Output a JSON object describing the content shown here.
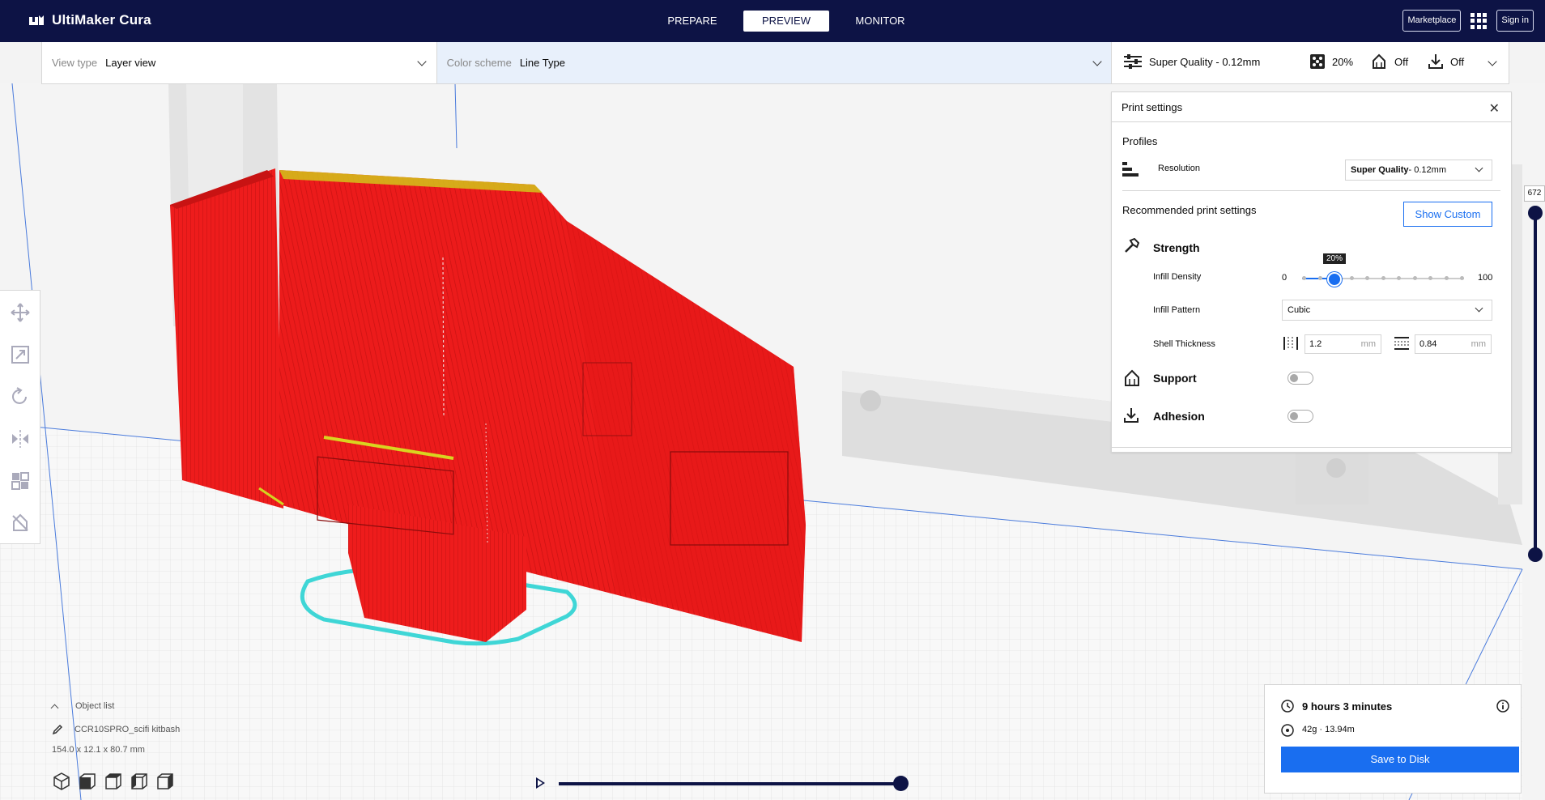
{
  "app": {
    "name": "UltiMaker Cura"
  },
  "stages": [
    {
      "label": "PREPARE",
      "active": false
    },
    {
      "label": "PREVIEW",
      "active": true
    },
    {
      "label": "MONITOR",
      "active": false
    }
  ],
  "topbar": {
    "marketplace": "Marketplace",
    "signin": "Sign in"
  },
  "viewbar": {
    "view_type_label": "View type",
    "view_type_value": "Layer view",
    "color_scheme_label": "Color scheme",
    "color_scheme_value": "Line Type"
  },
  "printbar": {
    "profile": "Super Quality - 0.12mm",
    "infill": "20%",
    "support": "Off",
    "adhesion": "Off"
  },
  "print_settings": {
    "title": "Print settings",
    "profiles_label": "Profiles",
    "resolution_label": "Resolution",
    "resolution_value_bold": "Super Quality",
    "resolution_value_rest": " - 0.12mm",
    "recommended_label": "Recommended print settings",
    "show_custom": "Show Custom",
    "strength": "Strength",
    "infill_density_label": "Infill Density",
    "infill_min": "0",
    "infill_max": "100",
    "infill_value": 20,
    "infill_tooltip": "20%",
    "infill_pattern_label": "Infill Pattern",
    "infill_pattern_value": "Cubic",
    "shell_label": "Shell Thickness",
    "wall_value": "1.2",
    "top_bottom_value": "0.84",
    "unit": "mm",
    "support": "Support",
    "support_enabled": false,
    "adhesion": "Adhesion",
    "adhesion_enabled": false
  },
  "object_list": {
    "header": "Object list",
    "name": "CCR10SPRO_scifi kitbash",
    "dims": "154.0 x 12.1 x 80.7 mm"
  },
  "job": {
    "time": "9 hours 3 minutes",
    "material": "42g · 13.94m",
    "save": "Save to Disk"
  },
  "layer": {
    "current": "672"
  },
  "colors": {
    "navbar": "#0d1345",
    "accent": "#196ef0",
    "model": "#e81818",
    "skirt": "#3fd6d6"
  },
  "icons": {
    "tools": [
      "move-icon",
      "scale-icon",
      "rotate-icon",
      "mirror-icon",
      "per-model-settings-icon",
      "support-blocker-icon"
    ],
    "camera": [
      "3d-view-icon",
      "front-view-icon",
      "top-view-icon",
      "left-view-icon",
      "right-view-icon"
    ]
  }
}
